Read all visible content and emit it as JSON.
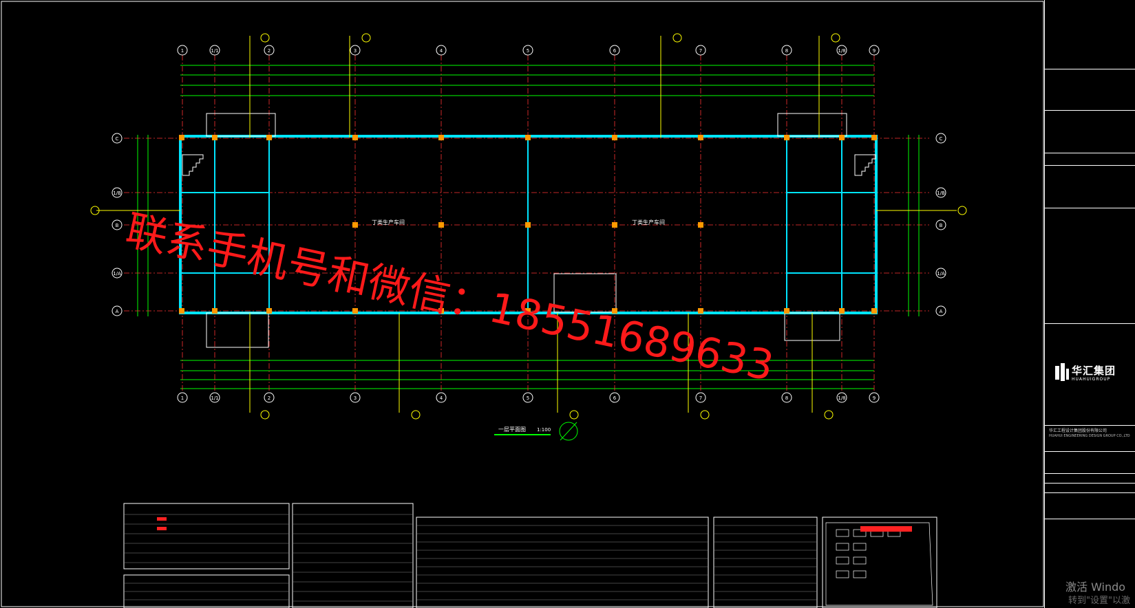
{
  "plan": {
    "grid_top_labels": [
      "1",
      "1/1",
      "2",
      "3",
      "4",
      "5",
      "6",
      "7",
      "8",
      "1/8",
      "9"
    ],
    "grid_side_labels": [
      "C",
      "1/B",
      "B",
      "1/A",
      "A"
    ],
    "room_label_left": "丁类生产车间",
    "room_label_right": "丁类生产车间",
    "sheet_title": "一层平面图",
    "sheet_scale": "1:100"
  },
  "watermark": {
    "text": "联系手机号和微信：18551689633",
    "color": "#ff1a1a"
  },
  "title_block": {
    "company_logo_text": "华汇集团",
    "company_logo_sub": "HUAHUIGROUP",
    "company_name_cn": "华汇工程设计集团股份有限公司",
    "company_name_en": "HUAHUI ENGINEERING DESIGN GROUP CO.,LTD"
  },
  "system_overlay": {
    "line1": "激活 Windo",
    "line2": "转到\"设置\"以激"
  },
  "colors": {
    "background": "#000000",
    "wall": "#00e5ff",
    "dimension": "#00ff00",
    "text_yellow": "#ffff00",
    "column": "#ff9900",
    "grid_line": "#ff3333",
    "red_text": "#ff1a1a"
  }
}
